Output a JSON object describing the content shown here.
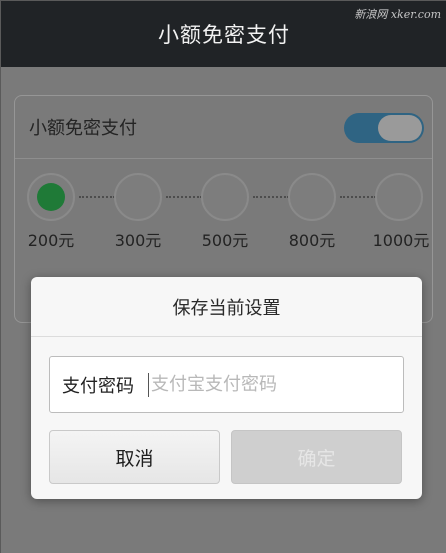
{
  "titlebar": {
    "title": "小额免密支付",
    "watermark": "新浪网 xker.com"
  },
  "settings": {
    "toggle_label": "小额免密支付",
    "toggle_on": true,
    "amounts": [
      "200元",
      "300元",
      "500元",
      "800元",
      "1000元"
    ],
    "selected_index": 0
  },
  "dialog": {
    "title": "保存当前设置",
    "password_label": "支付密码",
    "password_placeholder": "支付宝支付密码",
    "cancel_label": "取消",
    "ok_label": "确定"
  },
  "colors": {
    "titlebar_bg": "#202326",
    "switch_on": "#2f6483",
    "selected_dot": "#1f7a37",
    "dim_background": "#7a7a7a"
  }
}
